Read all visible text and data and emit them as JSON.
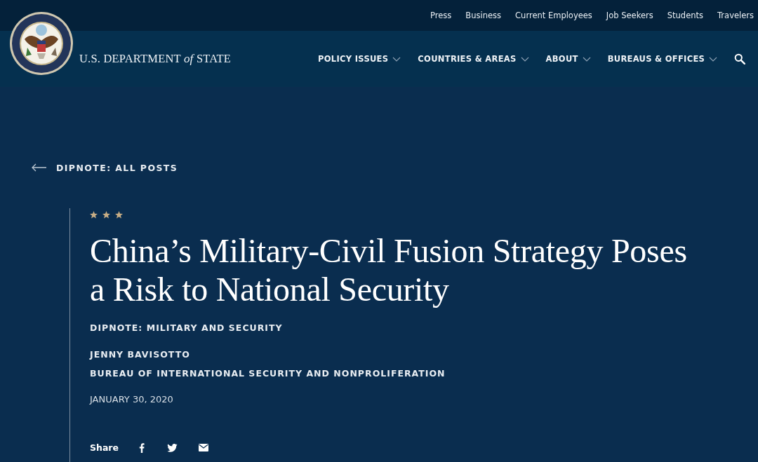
{
  "utility_links": [
    "Press",
    "Business",
    "Current Employees",
    "Job Seekers",
    "Students",
    "Travelers"
  ],
  "site_name": {
    "before": "U.S. DEPARTMENT",
    "italic": "of",
    "after": "STATE"
  },
  "main_nav": [
    {
      "label": "POLICY ISSUES"
    },
    {
      "label": "COUNTRIES & AREAS"
    },
    {
      "label": "ABOUT"
    },
    {
      "label": "BUREAUS & OFFICES"
    }
  ],
  "back_link": "DIPNOTE: ALL POSTS",
  "article": {
    "title": "China’s Military-Civil Fusion Strategy Poses a Risk to National Security",
    "category": "DIPNOTE: MILITARY AND SECURITY",
    "author": "JENNY BAVISOTTO",
    "bureau": "BUREAU OF INTERNATIONAL SECURITY AND NONPROLIFERATION",
    "date": "JANUARY 30, 2020"
  },
  "share": {
    "label": "Share",
    "networks": [
      {
        "kind": "facebook"
      },
      {
        "kind": "twitter"
      },
      {
        "kind": "email"
      }
    ]
  }
}
